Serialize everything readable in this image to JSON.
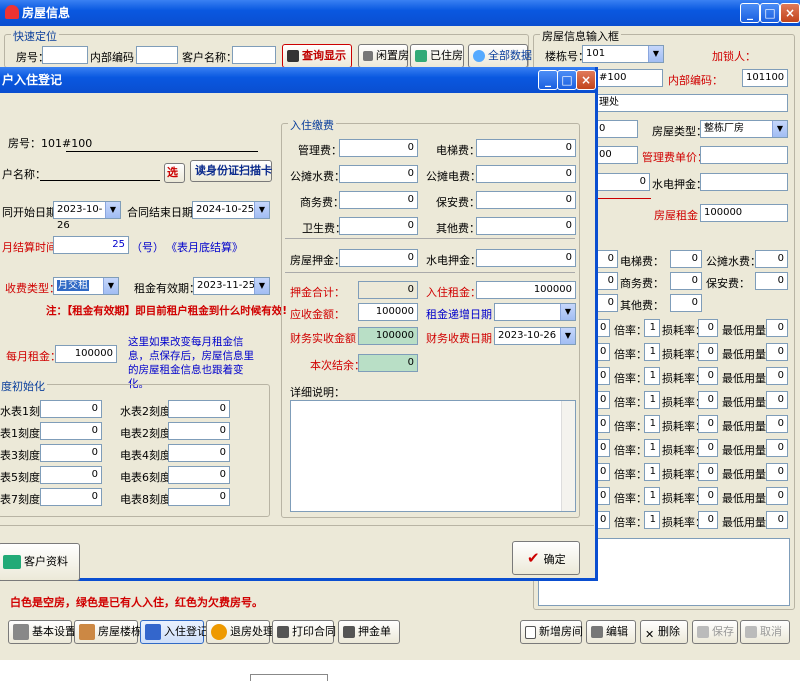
{
  "bg_window": {
    "title": "房屋信息",
    "quick_group": "快速定位",
    "room_label": "房号：",
    "code_label": "内部编码：",
    "customer_label": "客户名称：",
    "query_btn": "查询显示",
    "vacant_btn": "闲置房",
    "occupied_btn": "已住房",
    "all_btn": "全部数据",
    "legend": "白色是空房，绿色是已有人入住，红色为欠费房号。",
    "toolbar": [
      "基本设置",
      "房屋楼栋",
      "入住登记",
      "退房处理",
      "打印合同",
      "押金单"
    ],
    "right_btns": [
      "新增房间",
      "编辑",
      "删除",
      "保存",
      "取消"
    ]
  },
  "right_panel": {
    "title": "房屋信息输入框",
    "building_label": "楼栋号：",
    "building_value": "101",
    "linker_label": "加锁人：",
    "room_value": "#100",
    "code_label": "内部编码：",
    "code_value": "101100",
    "office_text": "理处",
    "frag_0": "0",
    "type_label": "房屋类型：",
    "type_value": "整栋厂房",
    "price_label": "管理费单价：",
    "frag_00": "00",
    "deposit_label": "水电押金：",
    "rent_label": "房屋租金：",
    "rent_value": "100000",
    "fee_rows": [
      {
        "l1": "电梯费：",
        "v1": "0",
        "l2": "公摊水费：",
        "v2": "0"
      },
      {
        "l1": "商务费：",
        "v1": "0",
        "l2": "保安费：",
        "v2": "0"
      },
      {
        "l1": "其他费：",
        "v1": "0",
        "l2": "",
        "v2": ""
      }
    ],
    "meter_row": {
      "rate": "倍率：",
      "rate_val": "1",
      "loss": "损耗率：",
      "loss_val": "0",
      "min": "最低用量：",
      "min_val": "0",
      "lead": "0"
    }
  },
  "dialog": {
    "title": "户入住登记",
    "room_label": "房号：101#100",
    "name_label": "户名称：",
    "select_btn": "选",
    "id_scan_btn": "读身份证扫描卡",
    "start_label": "同开始日期：",
    "start_value": "2023-10-26",
    "end_label": "合同结束日期：",
    "end_value": "2024-10-25",
    "settle_label": "月结算时间：",
    "settle_value": "25",
    "settle_unit": "（号）",
    "settle_note": "《表月底结算》",
    "charge_type_label": "收费类型：",
    "charge_type_value": "月交租",
    "rent_valid_label": "租金有效期：",
    "rent_valid_value": "2023-11-25",
    "note": "注：【租金有效期】即目前租户租金到什么时候有效!",
    "monthly_rent_label": "每月租金：",
    "monthly_rent_value": "100000",
    "hint": "这里如果改变每月租金信息，点保存后，房屋信息里的房屋租金信息也跟着变化。",
    "meter_group": "度初始化",
    "meters": [
      {
        "l": "水表1刻度",
        "v": "0",
        "r": "水表2刻度",
        "rv": "0"
      },
      {
        "l": "表1刻度",
        "v": "0",
        "r": "电表2刻度",
        "rv": "0"
      },
      {
        "l": "表3刻度",
        "v": "0",
        "r": "电表4刻度",
        "rv": "0"
      },
      {
        "l": "表5刻度",
        "v": "0",
        "r": "电表6刻度",
        "rv": "0"
      },
      {
        "l": "表7刻度",
        "v": "0",
        "r": "电表8刻度",
        "rv": "0"
      }
    ],
    "fee_group": "入住缴费",
    "fees": [
      {
        "l": "管理费：",
        "v": "0",
        "r": "电梯费：",
        "rv": "0"
      },
      {
        "l": "公摊水费：",
        "v": "0",
        "r": "公摊电费：",
        "rv": "0"
      },
      {
        "l": "商务费：",
        "v": "0",
        "r": "保安费：",
        "rv": "0"
      },
      {
        "l": "卫生费：",
        "v": "0",
        "r": "其他费：",
        "rv": "0"
      }
    ],
    "house_deposit_label": "房屋押金：",
    "house_deposit_value": "0",
    "water_deposit_label": "水电押金：",
    "water_deposit_value": "0",
    "deposit_total_label": "押金合计：",
    "deposit_total_value": "0",
    "checkin_rent_label": "入住租金：",
    "checkin_rent_value": "100000",
    "receivable_label": "应收金额：",
    "receivable_value": "100000",
    "increase_date_label": "租金递增日期：",
    "actual_label": "财务实收金额：",
    "actual_value": "100000",
    "finance_date_label": "财务收费日期：",
    "finance_date_value": "2023-10-26",
    "balance_label": "本次结余：",
    "balance_value": "0",
    "detail_label": "详细说明：",
    "customer_btn": "客户资料",
    "ok_btn": "确定"
  }
}
